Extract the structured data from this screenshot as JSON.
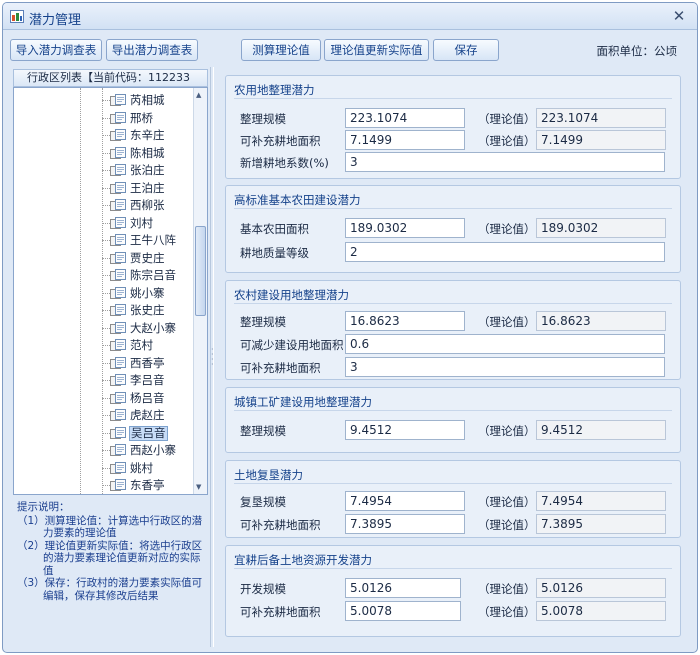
{
  "window": {
    "title": "潜力管理",
    "close_glyph": "✕"
  },
  "toolbar": {
    "import_label": "导入潜力调查表",
    "export_label": "导出潜力调查表",
    "calc_label": "测算理论值",
    "update_label": "理论值更新实际值",
    "save_label": "保存",
    "unit_text": "面积单位：公顷"
  },
  "tree": {
    "header": "行政区列表【当前代码：112233",
    "selected_index": 19,
    "items": [
      "芮相城",
      "邢桥",
      "东辛庄",
      "陈相城",
      "张泊庄",
      "王泊庄",
      "西柳张",
      "刘村",
      "王牛八阵",
      "贾史庄",
      "陈宗吕音",
      "姚小寨",
      "张史庄",
      "大赵小寨",
      "范村",
      "西香亭",
      "李吕音",
      "杨吕音",
      "虎赵庄",
      "吴吕音",
      "西赵小寨",
      "姚村",
      "东香亭"
    ]
  },
  "hints": {
    "title": "提示说明：",
    "items": [
      "（1）测算理论值：计算选中行政区的潜力要素的理论值",
      "（2）理论值更新实际值：将选中行政区的潜力要素理论值更新对应的实际值",
      "（3）保存：行政村的潜力要素实际值可编辑，保存其修改后结果"
    ]
  },
  "theory_label": "（理论值）",
  "sections": [
    {
      "title": "农用地整理潜力",
      "rows": [
        {
          "label": "整理规模",
          "value": "223.1074",
          "theory": "223.1074"
        },
        {
          "label": "可补充耕地面积",
          "value": "7.1499",
          "theory": "7.1499"
        },
        {
          "label": "新增耕地系数(%)",
          "value": "3"
        }
      ]
    },
    {
      "title": "高标准基本农田建设潜力",
      "rows": [
        {
          "label": "基本农田面积",
          "value": "189.0302",
          "theory": "189.0302"
        },
        {
          "label": "耕地质量等级",
          "value": "2"
        }
      ]
    },
    {
      "title": "农村建设用地整理潜力",
      "rows": [
        {
          "label": "整理规模",
          "value": "16.8623",
          "theory": "16.8623"
        },
        {
          "label": "可减少建设用地面积",
          "value": "0.6"
        },
        {
          "label": "可补充耕地面积",
          "value": "3"
        }
      ]
    },
    {
      "title": "城镇工矿建设用地整理潜力",
      "rows": [
        {
          "label": "整理规模",
          "value": "9.4512",
          "theory": "9.4512"
        }
      ]
    },
    {
      "title": "土地复垦潜力",
      "rows": [
        {
          "label": "复垦规模",
          "value": "7.4954",
          "theory": "7.4954"
        },
        {
          "label": "可补充耕地面积",
          "value": "7.3895",
          "theory": "7.3895"
        }
      ]
    },
    {
      "title": "宜耕后备土地资源开发潜力",
      "rows": [
        {
          "label": "开发规模",
          "value": "5.0126",
          "theory": "5.0126"
        },
        {
          "label": "可补充耕地面积",
          "value": "5.0078",
          "theory": "5.0078"
        }
      ]
    }
  ]
}
